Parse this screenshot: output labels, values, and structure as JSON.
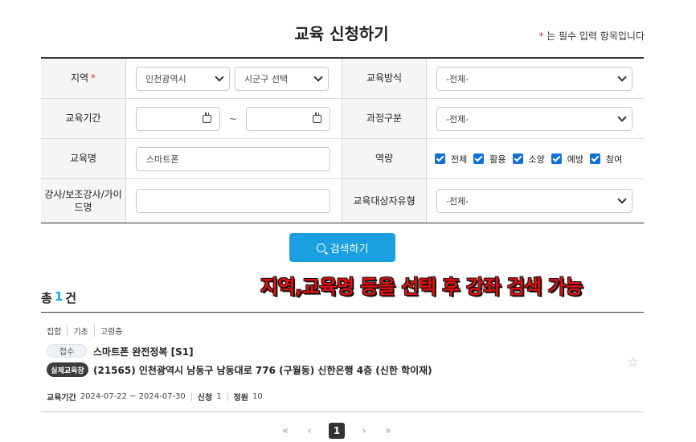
{
  "page": {
    "title": "교육 신청하기",
    "required_star": "*",
    "required_note": "는 필수 입력 항목입니다"
  },
  "form": {
    "region": {
      "label": "지역",
      "required": "*",
      "city_value": "인천광역시",
      "district_value": "시군구 선택"
    },
    "method": {
      "label": "교육방식",
      "value": "-전체-"
    },
    "period": {
      "label": "교육기간",
      "start": "",
      "end": "",
      "separator": "~"
    },
    "course_type": {
      "label": "과정구분",
      "value": "-전체-"
    },
    "name": {
      "label": "교육명",
      "value": "스마트폰"
    },
    "competency": {
      "label": "역량",
      "options": [
        "전체",
        "활용",
        "소양",
        "예방",
        "참여"
      ]
    },
    "instructor": {
      "label": "강사/보조강사/가이드명",
      "value": ""
    },
    "target": {
      "label": "교육대상자유형",
      "value": "-전체-"
    }
  },
  "search_button": {
    "label": "검색하기",
    "icon": "search-icon"
  },
  "overlay_caption": "지역,교육명 등을 선택 후 강좌 검색 가능",
  "results": {
    "total_prefix": "총",
    "total_count": "1",
    "total_suffix": "건",
    "items": [
      {
        "tags": [
          "집합",
          "기초",
          "고령층"
        ],
        "status": "접수",
        "title": "스마트폰 완전정복 [S1]",
        "location_badge": "실제교육장",
        "address": "(21565) 인천광역시 남동구 남동대로 776 (구월동) 신한은행 4층 (신한 학이재)",
        "period_label": "교육기간",
        "period_value": "2024-07-22 ~ 2024-07-30",
        "applied_label": "신청",
        "applied_value": "1",
        "capacity_label": "정원",
        "capacity_value": "10",
        "favorite_icon": "star-icon"
      }
    ]
  },
  "pagination": {
    "first": "«",
    "prev": "‹",
    "current": "1",
    "next": "›",
    "last": "»"
  },
  "colors": {
    "accent": "#1a9fe0",
    "checkbox": "#1170d6",
    "required": "#d33333",
    "overlay": "#e01010"
  }
}
